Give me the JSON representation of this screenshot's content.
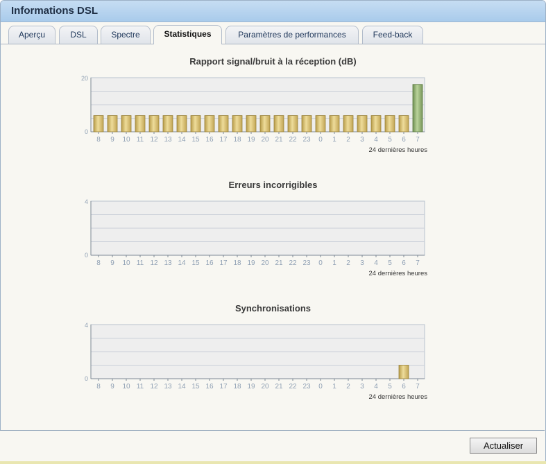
{
  "window": {
    "title": "Informations DSL"
  },
  "tabs": [
    {
      "label": "Aperçu",
      "active": false
    },
    {
      "label": "DSL",
      "active": false
    },
    {
      "label": "Spectre",
      "active": false
    },
    {
      "label": "Statistiques",
      "active": true
    },
    {
      "label": "Paramètres de performances",
      "active": false
    },
    {
      "label": "Feed-back",
      "active": false
    }
  ],
  "colors": {
    "bar": "#d9c27a",
    "bar_highlight": "#8fae6f",
    "plot_bg": "#eeeeee",
    "grid": "#c9cfd8",
    "axis_label": "#8fa0b4"
  },
  "chart_data": [
    {
      "type": "bar",
      "title": "Rapport signal/bruit à la réception (dB)",
      "xlabel": "24 dernières heures",
      "categories": [
        "8",
        "9",
        "10",
        "11",
        "12",
        "13",
        "14",
        "15",
        "16",
        "17",
        "18",
        "19",
        "20",
        "21",
        "22",
        "23",
        "0",
        "1",
        "2",
        "3",
        "4",
        "5",
        "6",
        "7"
      ],
      "values": [
        6,
        6,
        6,
        6,
        6,
        6,
        6,
        6,
        6,
        6,
        6,
        6,
        6,
        6,
        6,
        6,
        6,
        6,
        6,
        6,
        6,
        6,
        6,
        17.5
      ],
      "ylim": [
        0,
        20
      ],
      "yticks": [
        "20",
        "0"
      ],
      "grid": true
    },
    {
      "type": "bar",
      "title": "Erreurs incorrigibles",
      "xlabel": "24 dernières heures",
      "categories": [
        "8",
        "9",
        "10",
        "11",
        "12",
        "13",
        "14",
        "15",
        "16",
        "17",
        "18",
        "19",
        "20",
        "21",
        "22",
        "23",
        "0",
        "1",
        "2",
        "3",
        "4",
        "5",
        "6",
        "7"
      ],
      "values": [
        0,
        0,
        0,
        0,
        0,
        0,
        0,
        0,
        0,
        0,
        0,
        0,
        0,
        0,
        0,
        0,
        0,
        0,
        0,
        0,
        0,
        0,
        0,
        0
      ],
      "ylim": [
        0,
        4
      ],
      "yticks": [
        "4",
        "0"
      ],
      "grid": true
    },
    {
      "type": "bar",
      "title": "Synchronisations",
      "xlabel": "24 dernières heures",
      "categories": [
        "8",
        "9",
        "10",
        "11",
        "12",
        "13",
        "14",
        "15",
        "16",
        "17",
        "18",
        "19",
        "20",
        "21",
        "22",
        "23",
        "0",
        "1",
        "2",
        "3",
        "4",
        "5",
        "6",
        "7"
      ],
      "values": [
        0,
        0,
        0,
        0,
        0,
        0,
        0,
        0,
        0,
        0,
        0,
        0,
        0,
        0,
        0,
        0,
        0,
        0,
        0,
        0,
        0,
        0,
        1,
        0
      ],
      "ylim": [
        0,
        4
      ],
      "yticks": [
        "4",
        "0"
      ],
      "grid": true
    }
  ],
  "footer": {
    "refresh_label": "Actualiser"
  }
}
